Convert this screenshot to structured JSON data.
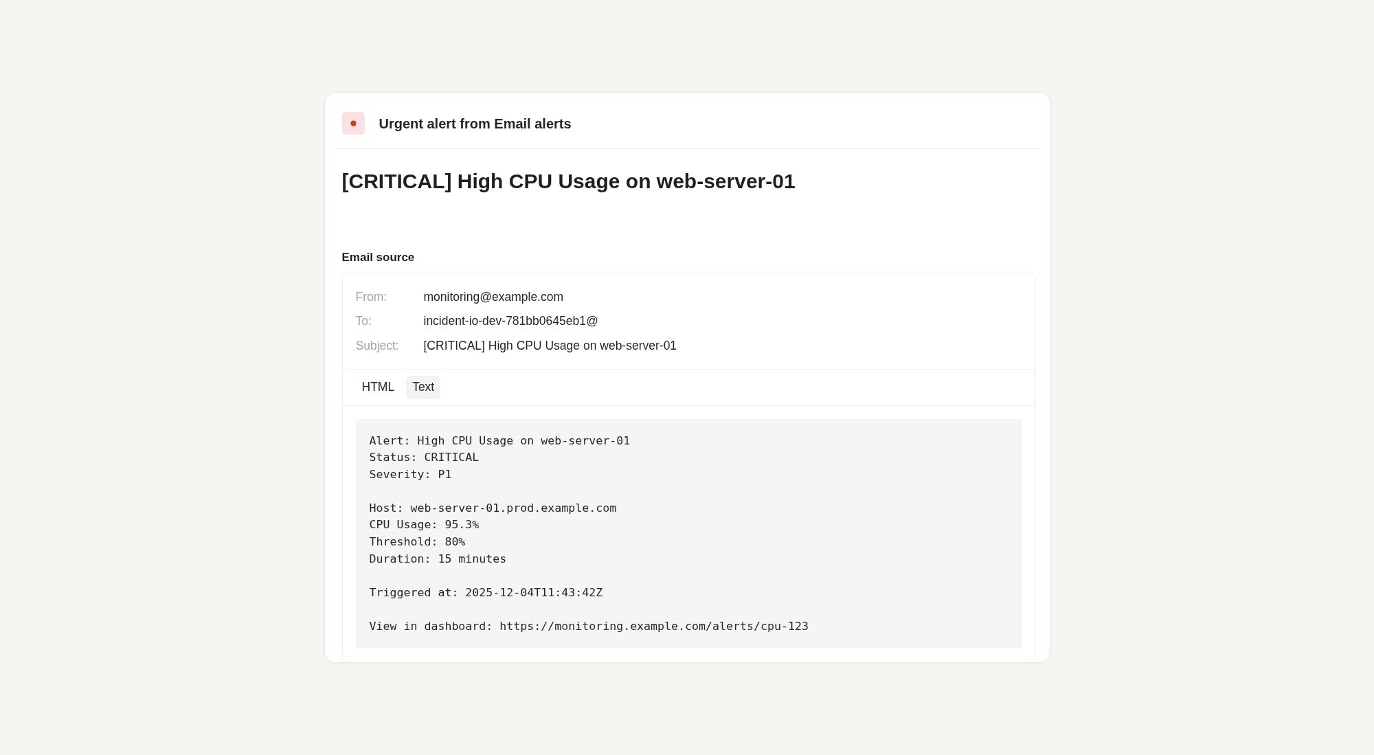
{
  "alert": {
    "title": "Urgent alert from Email alerts"
  },
  "heading": "[CRITICAL] High CPU Usage on web-server-01",
  "email_source": {
    "title": "Email source",
    "fields": [
      {
        "label": "From:",
        "value": "monitoring@example.com"
      },
      {
        "label": "To:",
        "value": "incident-io-dev-781bb0645eb1@"
      },
      {
        "label": "Subject:",
        "value": "[CRITICAL] High CPU Usage on web-server-01"
      }
    ],
    "tabs": [
      {
        "label": "HTML",
        "selected": false
      },
      {
        "label": "Text",
        "selected": true
      }
    ],
    "body": "Alert: High CPU Usage on web-server-01\nStatus: CRITICAL\nSeverity: P1\n\nHost: web-server-01.prod.example.com\nCPU Usage: 95.3%\nThreshold: 80%\nDuration: 15 minutes\n\nTriggered at: 2025-12-04T11:43:42Z\n\nView in dashboard: https://monitoring.example.com/alerts/cpu-123"
  }
}
